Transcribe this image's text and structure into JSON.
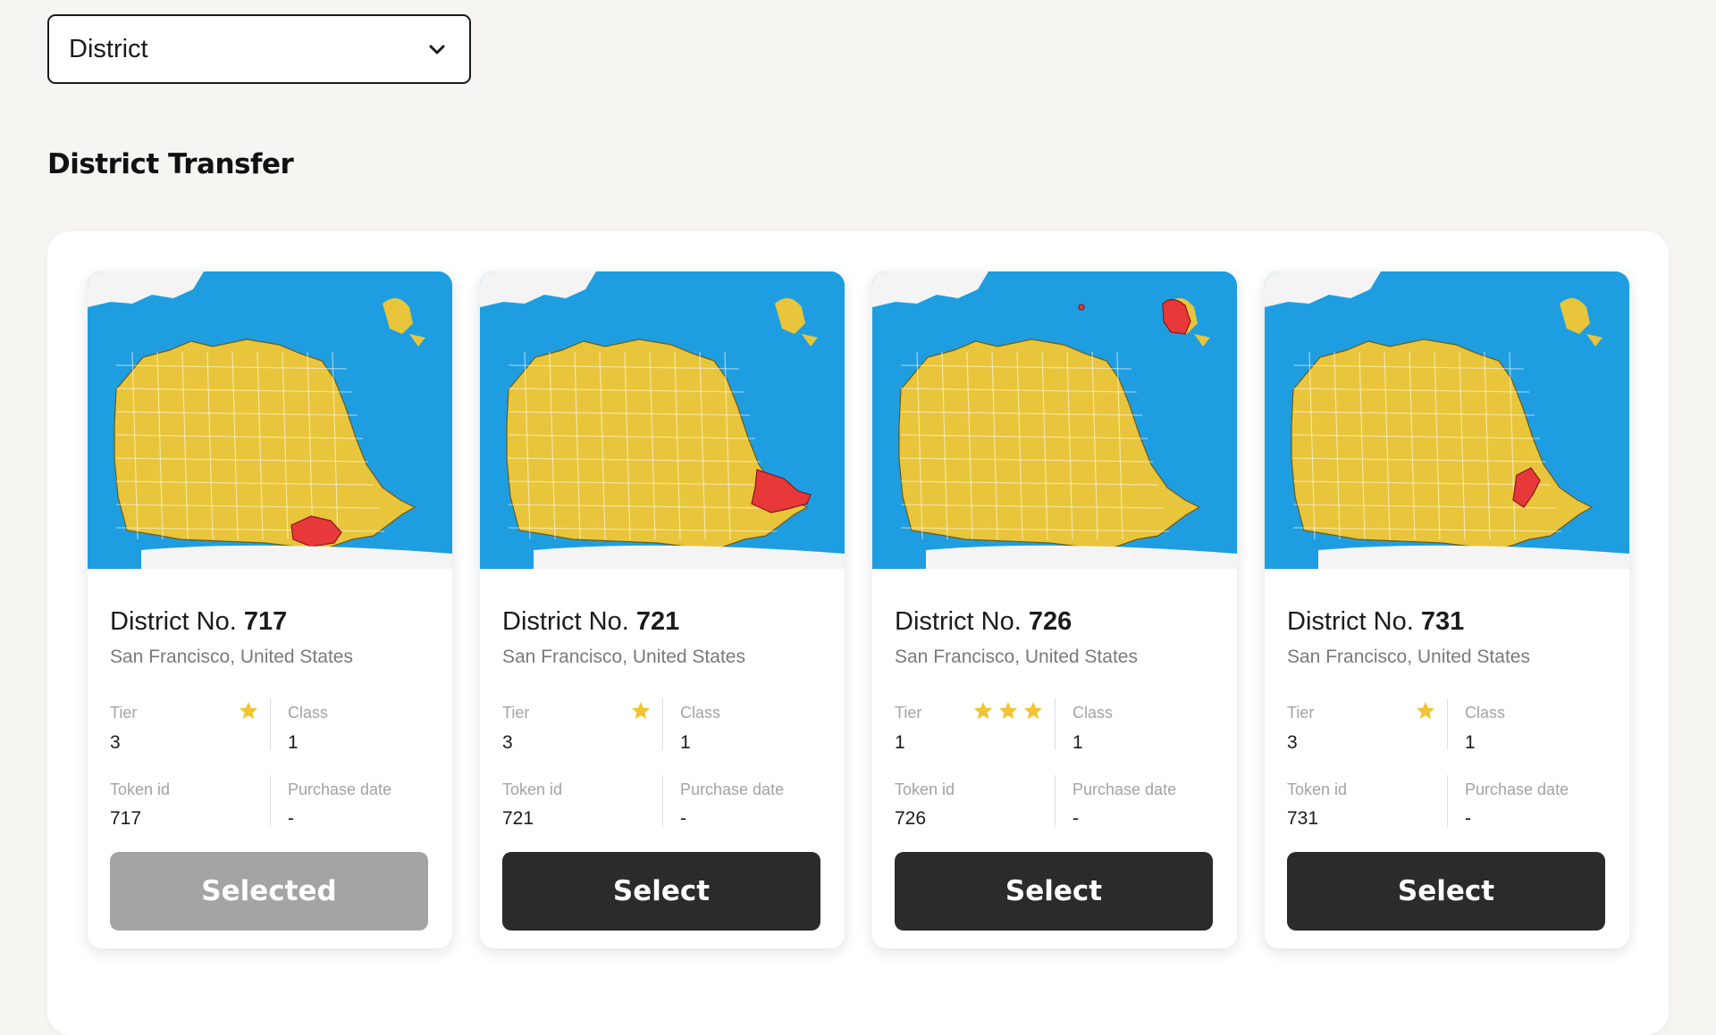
{
  "filter": {
    "value": "District"
  },
  "section_title": "District Transfer",
  "colors": {
    "water": "#1e9ee1",
    "land": "#e8c53b",
    "highlight": "#e8393a",
    "star": "#f3c431",
    "button_dark": "#2b2b2b",
    "button_disabled": "#a4a4a4"
  },
  "labels": {
    "tier": "Tier",
    "class": "Class",
    "token_id": "Token id",
    "purchase_date": "Purchase date"
  },
  "cards": [
    {
      "prefix": "District No.",
      "number": "717",
      "location": "San Francisco, United States",
      "tier": "3",
      "stars": 1,
      "class": "1",
      "token_id": "717",
      "purchase_date": "-",
      "button": "Selected",
      "button_state": "selected"
    },
    {
      "prefix": "District No.",
      "number": "721",
      "location": "San Francisco, United States",
      "tier": "3",
      "stars": 1,
      "class": "1",
      "token_id": "721",
      "purchase_date": "-",
      "button": "Select",
      "button_state": "select"
    },
    {
      "prefix": "District No.",
      "number": "726",
      "location": "San Francisco, United States",
      "tier": "1",
      "stars": 3,
      "class": "1",
      "token_id": "726",
      "purchase_date": "-",
      "button": "Select",
      "button_state": "select"
    },
    {
      "prefix": "District No.",
      "number": "731",
      "location": "San Francisco, United States",
      "tier": "3",
      "stars": 1,
      "class": "1",
      "token_id": "731",
      "purchase_date": "-",
      "button": "Select",
      "button_state": "select"
    }
  ]
}
